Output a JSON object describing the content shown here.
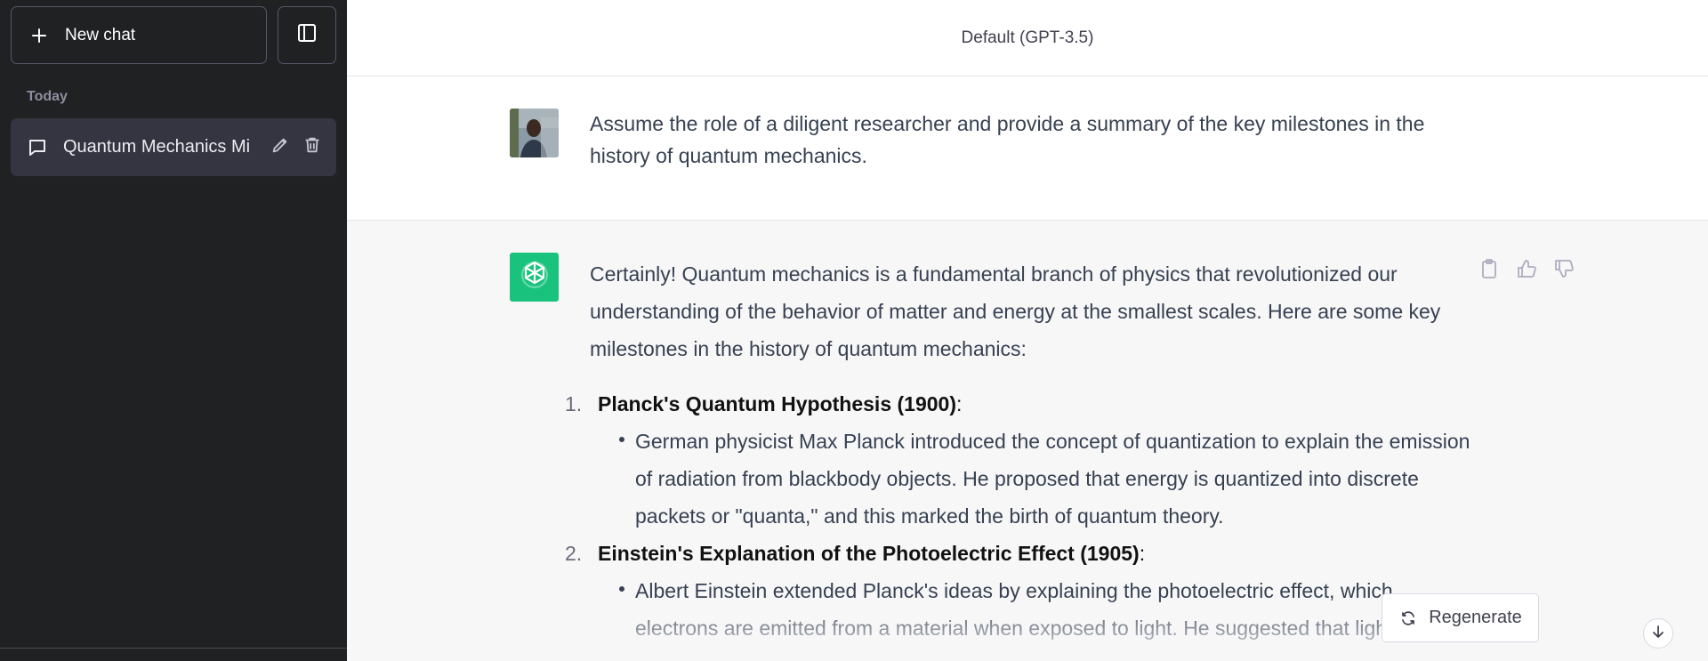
{
  "sidebar": {
    "new_chat_label": "New chat",
    "section_label": "Today",
    "conversations": [
      {
        "title": "Quantum Mechanics Mi"
      }
    ]
  },
  "header": {
    "model_label": "Default (GPT-3.5)"
  },
  "messages": {
    "user": {
      "text": "Assume the role of a diligent researcher and provide a summary of the key milestones in the history of quantum mechanics."
    },
    "assistant": {
      "intro": "Certainly! Quantum mechanics is a fundamental branch of physics that revolutionized our understanding of the behavior of matter and energy at the smallest scales. Here are some key milestones in the history of quantum mechanics:",
      "items": [
        {
          "number": "1.",
          "heading": "Planck's Quantum Hypothesis (1900)",
          "colon": ":",
          "bullet": "German physicist Max Planck introduced the concept of quantization to explain the emission of radiation from blackbody objects. He proposed that energy is quantized into discrete packets or \"quanta,\" and this marked the birth of quantum theory."
        },
        {
          "number": "2.",
          "heading": "Einstein's Explanation of the Photoelectric Effect (1905)",
          "colon": ":",
          "bullet": "Albert Einstein extended Planck's ideas by explaining the photoelectric effect, which electrons are emitted from a material when exposed to light. He suggested that light"
        }
      ]
    }
  },
  "controls": {
    "regenerate_label": "Regenerate"
  },
  "icons": {
    "plus": "plus-icon",
    "sidebar_toggle": "sidebar-toggle-icon",
    "chat": "chat-bubble-icon",
    "edit": "pencil-icon",
    "delete": "trash-icon",
    "copy": "clipboard-icon",
    "thumbs_up": "thumbs-up-icon",
    "thumbs_down": "thumbs-down-icon",
    "regenerate": "refresh-icon",
    "scroll_down": "arrow-down-icon"
  },
  "colors": {
    "sidebar_bg": "#202123",
    "selected_item_bg": "#343541",
    "assistant_bg": "#f7f7f8",
    "assistant_avatar": "#19c37d"
  }
}
